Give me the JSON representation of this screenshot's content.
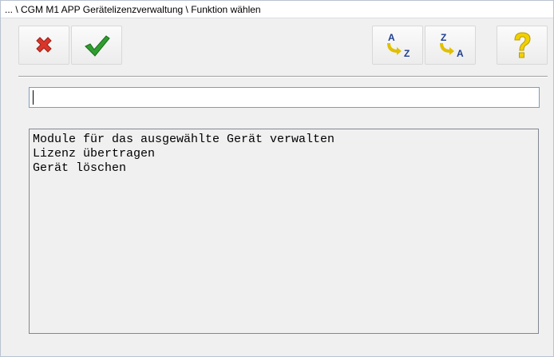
{
  "window": {
    "title": "... \\ CGM M1 APP Gerätelizenzverwaltung \\ Funktion wählen"
  },
  "toolbar": {
    "buttons": [
      {
        "name": "cancel-button",
        "icon": "red-x-icon",
        "color": "#d9362b"
      },
      {
        "name": "ok-button",
        "icon": "green-checkmark-icon",
        "color": "#2e9e2e"
      },
      {
        "name": "sort-ascending-button",
        "icon": "sort-a-to-z-icon",
        "top_letter": "A",
        "bottom_letter": "Z"
      },
      {
        "name": "sort-descending-button",
        "icon": "sort-z-to-a-icon",
        "top_letter": "Z",
        "bottom_letter": "A"
      },
      {
        "name": "help-button",
        "icon": "question-mark-icon",
        "color": "#f2d000"
      }
    ]
  },
  "search": {
    "value": "",
    "placeholder": ""
  },
  "functions": {
    "items": [
      "Module für das ausgewählte Gerät verwalten",
      "Lizenz übertragen",
      "Gerät löschen"
    ]
  },
  "colors": {
    "background": "#f0f0f0",
    "input_border": "#7a9cc6",
    "sort_letter": "#1f3f8f",
    "sort_arrow": "#e0c000"
  }
}
